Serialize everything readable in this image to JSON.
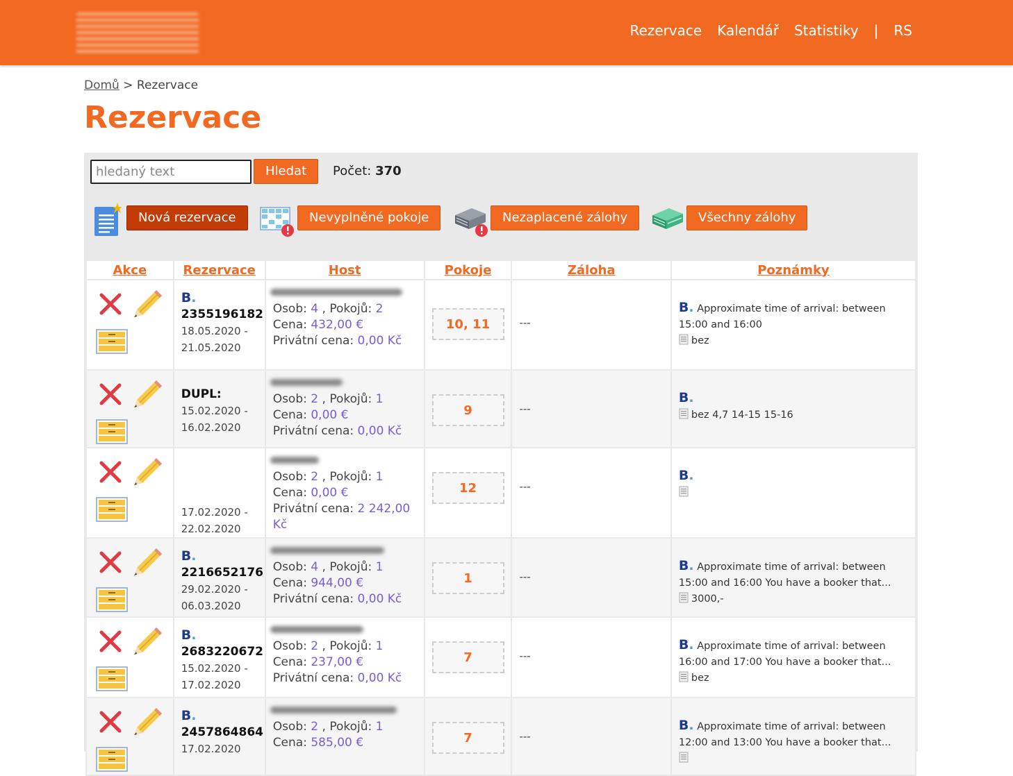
{
  "nav": {
    "items": [
      "Rezervace",
      "Kalendář",
      "Statistiky"
    ],
    "separator": "|",
    "user": "RS"
  },
  "breadcrumb": {
    "home": "Domů",
    "sep": ">",
    "current": "Rezervace"
  },
  "page_title": "Rezervace",
  "toolbar": {
    "search_placeholder": "hledaný text",
    "search_button": "Hledat",
    "count_label": "Počet:",
    "count_value": "370",
    "new_reservation": "Nová rezervace",
    "unfilled_rooms": "Nevyplněné pokoje",
    "unpaid_deposits": "Nezaplacené zálohy",
    "all_deposits": "Všechny zálohy"
  },
  "table": {
    "headers": [
      "Akce",
      "Rezervace",
      "Host",
      "Pokoje",
      "Záloha",
      "Poznámky"
    ],
    "labels": {
      "persons": "Osob:",
      "rooms": "Pokojů:",
      "price": "Cena:",
      "private_price": "Privátní cena:"
    },
    "rows": [
      {
        "source": "B",
        "number": "2355196182",
        "from": "18.05.2020 -",
        "to": "21.05.2020",
        "persons": "4",
        "rooms": "2",
        "price": "432,00 €",
        "private": "0,00 Kč",
        "room_no": "10, 11",
        "deposit": "---",
        "note": "Approximate time of arrival: between 15:00 and 16:00",
        "extra": "bez"
      },
      {
        "source": "",
        "number": "DUPL:",
        "from": "15.02.2020 -",
        "to": "16.02.2020",
        "persons": "2",
        "rooms": "1",
        "price": "0,00 €",
        "private": "0,00 Kč",
        "room_no": "9",
        "deposit": "---",
        "note": "",
        "extra": "bez 4,7 14-15 15-16"
      },
      {
        "source": "",
        "number": "",
        "from": "17.02.2020 -",
        "to": "22.02.2020",
        "persons": "2",
        "rooms": "1",
        "price": "0,00 €",
        "private": "2 242,00 Kč",
        "room_no": "12",
        "deposit": "---",
        "note": "",
        "extra": ""
      },
      {
        "source": "B",
        "number": "2216652176",
        "from": "29.02.2020 -",
        "to": "06.03.2020",
        "persons": "4",
        "rooms": "1",
        "price": "944,00 €",
        "private": "0,00 Kč",
        "room_no": "1",
        "deposit": "---",
        "note": "Approximate time of arrival: between 15:00 and 16:00 You have a booker that...",
        "extra": "3000,-"
      },
      {
        "source": "B",
        "number": "2683220672",
        "from": "15.02.2020 -",
        "to": "17.02.2020",
        "persons": "2",
        "rooms": "1",
        "price": "237,00 €",
        "private": "0,00 Kč",
        "room_no": "7",
        "deposit": "---",
        "note": "Approximate time of arrival: between 16:00 and 17:00 You have a booker that...",
        "extra": "bez"
      },
      {
        "source": "B",
        "number": "2457864864",
        "from": "17.02.2020",
        "to": "",
        "persons": "2",
        "rooms": "1",
        "price": "585,00 €",
        "private": "",
        "room_no": "7",
        "deposit": "---",
        "note": "Approximate time of arrival: between 12:00 and 13:00 You have a booker that...",
        "extra": ""
      }
    ]
  },
  "colors": {
    "brand": "#f26a22",
    "dark_button": "#c33c08",
    "value": "#7a5bd6"
  },
  "icons": [
    "new-document-icon",
    "room-grid-alert-icon",
    "money-stack-alert-icon",
    "money-stack-icon",
    "delete-icon",
    "edit-pencil-icon",
    "cabinet-icon",
    "note-icon",
    "booking-logo-icon"
  ]
}
